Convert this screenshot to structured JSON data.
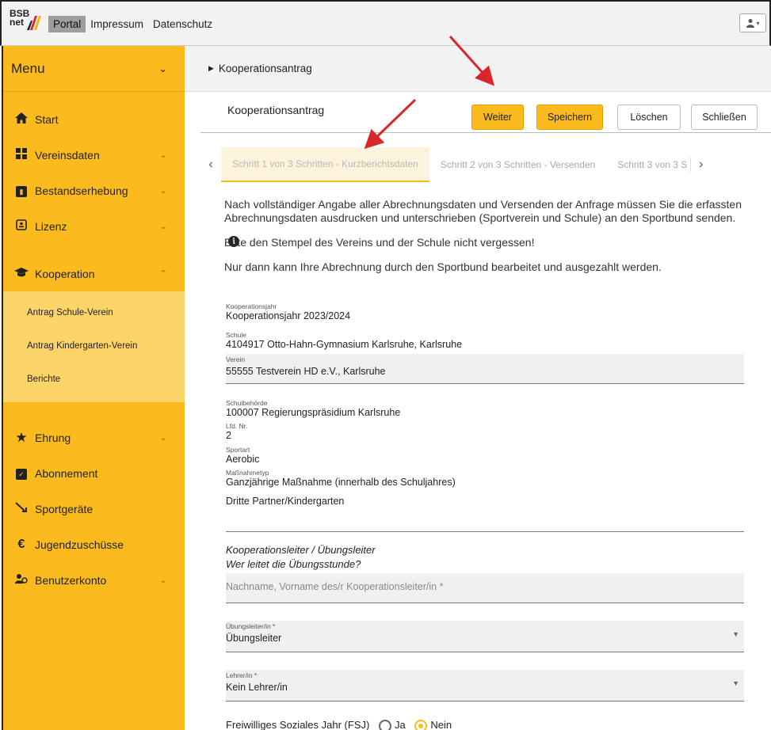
{
  "topbar": {
    "logo_text": "BSB net",
    "nav": [
      "Portal",
      "Impressum",
      "Datenschutz"
    ],
    "user_icon": "user-icon"
  },
  "sidebar": {
    "menu_label": "Menu",
    "items": [
      {
        "label": "Start",
        "icon": "home-icon"
      },
      {
        "label": "Vereinsdaten",
        "icon": "grid-icon"
      },
      {
        "label": "Bestandserhebung",
        "icon": "chart-icon"
      },
      {
        "label": "Lizenz",
        "icon": "badge-icon"
      },
      {
        "label": "Kooperation",
        "icon": "graduation-cap-icon"
      }
    ],
    "sub_items": [
      "Antrag Schule-Verein",
      "Antrag Kindergarten-Verein",
      "Berichte"
    ],
    "items2": [
      {
        "label": "Ehrung",
        "icon": "star-icon"
      },
      {
        "label": "Abonnement",
        "icon": "subscription-icon"
      },
      {
        "label": "Sportgeräte",
        "icon": "equipment-icon"
      },
      {
        "label": "Jugendzuschüsse",
        "icon": "euro-icon"
      },
      {
        "label": "Benutzerkonto",
        "icon": "users-icon"
      }
    ]
  },
  "breadcrumb": "Kooperationsantrag",
  "card": {
    "title": "Kooperationsantrag",
    "buttons": {
      "next": "Weiter",
      "save": "Speichern",
      "delete": "Löschen",
      "close": "Schließen"
    }
  },
  "steps": [
    "Schritt 1 von 3 Schritten - Kurzberichtsdaten",
    "Schritt 2 von 3 Schritten - Versenden",
    "Schritt 3 von 3 S"
  ],
  "info": {
    "p1": "Nach vollständiger Angabe aller Abrechnungsdaten und Versenden der Anfrage müssen Sie die erfassten Abrechnungsdaten ausdrucken und unterschrieben (Sportverein und Schule) an den Sportbund senden.",
    "p2": "Bitte den Stempel des Vereins und der Schule nicht vergessen!",
    "p3": "Nur dann kann Ihre Abrechnung durch den Sportbund bearbeitet und ausgezahlt werden."
  },
  "form": {
    "kooperationsjahr": {
      "label": "Kooperationsjahr",
      "value": "Kooperationsjahr 2023/2024"
    },
    "schule": {
      "label": "Schule",
      "value": "4104917 Otto-Hahn-Gymnasium Karlsruhe, Karlsruhe"
    },
    "verein": {
      "label": "Verein",
      "value": "55555 Testverein HD e.V., Karlsruhe"
    },
    "schulbehoerde": {
      "label": "Schulbehörde",
      "value": "100007 Regierungspräsidium Karlsruhe"
    },
    "lfd_nr": {
      "label": "Lfd. Nr.",
      "value": "2"
    },
    "sportart": {
      "label": "Sportart",
      "value": "Aerobic"
    },
    "massnahmetyp": {
      "label": "Maßnahmetyp",
      "value": "Ganzjährige Maßnahme (innerhalb des Schuljahres)",
      "value2": "Dritte Partner/Kindergarten"
    },
    "leiter_heading": "Kooperationsleiter / Übungsleiter",
    "leiter_question": "Wer leitet die Übungsstunde?",
    "leiter_placeholder": "Nachname, Vorname des/r Kooperationsleiter/in *",
    "uebungsleiter": {
      "label": "Übungsleiter/in *",
      "value": "Übungsleiter"
    },
    "lehrer": {
      "label": "Lehrer/in *",
      "value": "Kein Lehrer/in"
    },
    "fsj": {
      "label": "Freiwilliges Soziales Jahr (FSJ)",
      "yes": "Ja",
      "no": "Nein"
    }
  },
  "colors": {
    "accent": "#fbbb1f",
    "arrow": "#d9262b"
  }
}
